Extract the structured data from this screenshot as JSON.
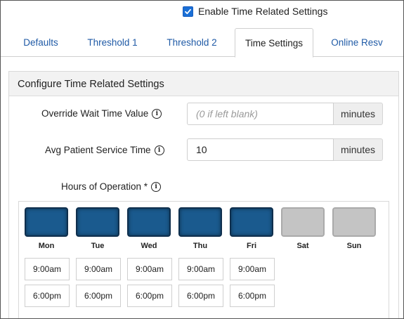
{
  "enable": {
    "label": "Enable Time Related Settings",
    "checked": true
  },
  "tabs": [
    {
      "label": "Defaults"
    },
    {
      "label": "Threshold 1"
    },
    {
      "label": "Threshold 2"
    },
    {
      "label": "Time Settings",
      "active": true
    },
    {
      "label": "Online Resv"
    }
  ],
  "panel": {
    "title": "Configure Time Related Settings",
    "override": {
      "label": "Override Wait Time Value",
      "value": "",
      "placeholder": "(0 if left blank)",
      "unit": "minutes"
    },
    "service": {
      "label": "Avg Patient Service Time",
      "value": "10",
      "unit": "minutes"
    },
    "hours_label": "Hours of Operation *"
  },
  "days": [
    {
      "name": "Mon",
      "enabled": true,
      "open": "9:00am",
      "close": "6:00pm"
    },
    {
      "name": "Tue",
      "enabled": true,
      "open": "9:00am",
      "close": "6:00pm"
    },
    {
      "name": "Wed",
      "enabled": true,
      "open": "9:00am",
      "close": "6:00pm"
    },
    {
      "name": "Thu",
      "enabled": true,
      "open": "9:00am",
      "close": "6:00pm"
    },
    {
      "name": "Fri",
      "enabled": true,
      "open": "9:00am",
      "close": "6:00pm"
    },
    {
      "name": "Sat",
      "enabled": false
    },
    {
      "name": "Sun",
      "enabled": false
    }
  ],
  "colors": {
    "day_on": "#1a5a8e",
    "day_off": "#c4c4c4",
    "link": "#1f5aa6",
    "checkbox": "#1a6fd6"
  }
}
